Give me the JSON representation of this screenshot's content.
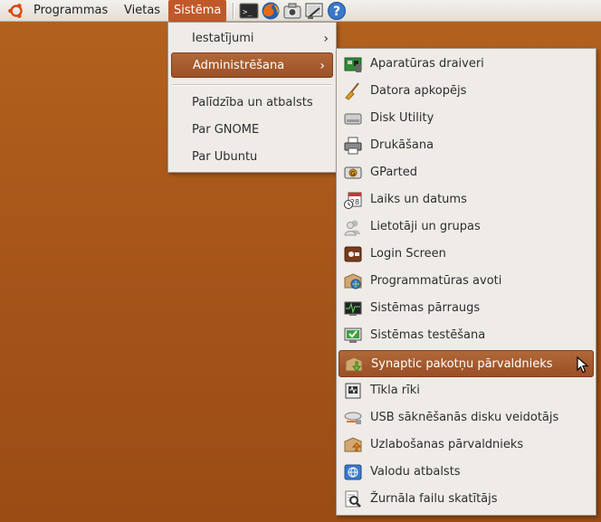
{
  "panel": {
    "menus": [
      "Programmas",
      "Vietas",
      "Sistēma"
    ],
    "launchers": [
      "terminal-icon",
      "firefox-icon",
      "screenshot-icon",
      "screen-capture-icon",
      "help-icon"
    ]
  },
  "system_menu": {
    "items": [
      {
        "label": "Iestatījumi",
        "submenu": true
      },
      {
        "label": "Administrēšana",
        "submenu": true,
        "highlighted": true
      },
      {
        "label": "Palīdzība un atbalsts"
      },
      {
        "label": "Par GNOME"
      },
      {
        "label": "Par Ubuntu"
      }
    ],
    "submenu_arrow": "›"
  },
  "admin_menu": {
    "items": [
      {
        "label": "Aparatūras draiveri",
        "icon": "hardware-driver-icon"
      },
      {
        "label": "Datora apkopējs",
        "icon": "broom-icon"
      },
      {
        "label": "Disk Utility",
        "icon": "disk-icon"
      },
      {
        "label": "Drukāšana",
        "icon": "printer-icon"
      },
      {
        "label": "GParted",
        "icon": "gparted-icon"
      },
      {
        "label": "Laiks un datums",
        "icon": "calendar-clock-icon"
      },
      {
        "label": "Lietotāji un grupas",
        "icon": "users-icon"
      },
      {
        "label": "Login Screen",
        "icon": "login-screen-icon"
      },
      {
        "label": "Programmatūras avoti",
        "icon": "software-sources-icon"
      },
      {
        "label": "Sistēmas pārraugs",
        "icon": "system-monitor-icon"
      },
      {
        "label": "Sistēmas testēšana",
        "icon": "system-testing-icon"
      },
      {
        "label": "Synaptic pakotņu pārvaldnieks",
        "icon": "synaptic-icon",
        "highlighted": true
      },
      {
        "label": "Tīkla rīki",
        "icon": "network-tools-icon"
      },
      {
        "label": "USB sāknēšanās disku veidotājs",
        "icon": "usb-creator-icon"
      },
      {
        "label": "Uzlabošanas pārvaldnieks",
        "icon": "update-manager-icon"
      },
      {
        "label": "Valodu atbalsts",
        "icon": "language-support-icon"
      },
      {
        "label": "Žurnāla failu skatītājs",
        "icon": "log-viewer-icon"
      }
    ]
  },
  "colors": {
    "desktop": "#a8561a",
    "highlight": "#a65a2e",
    "menu_bg": "#efebe7"
  }
}
